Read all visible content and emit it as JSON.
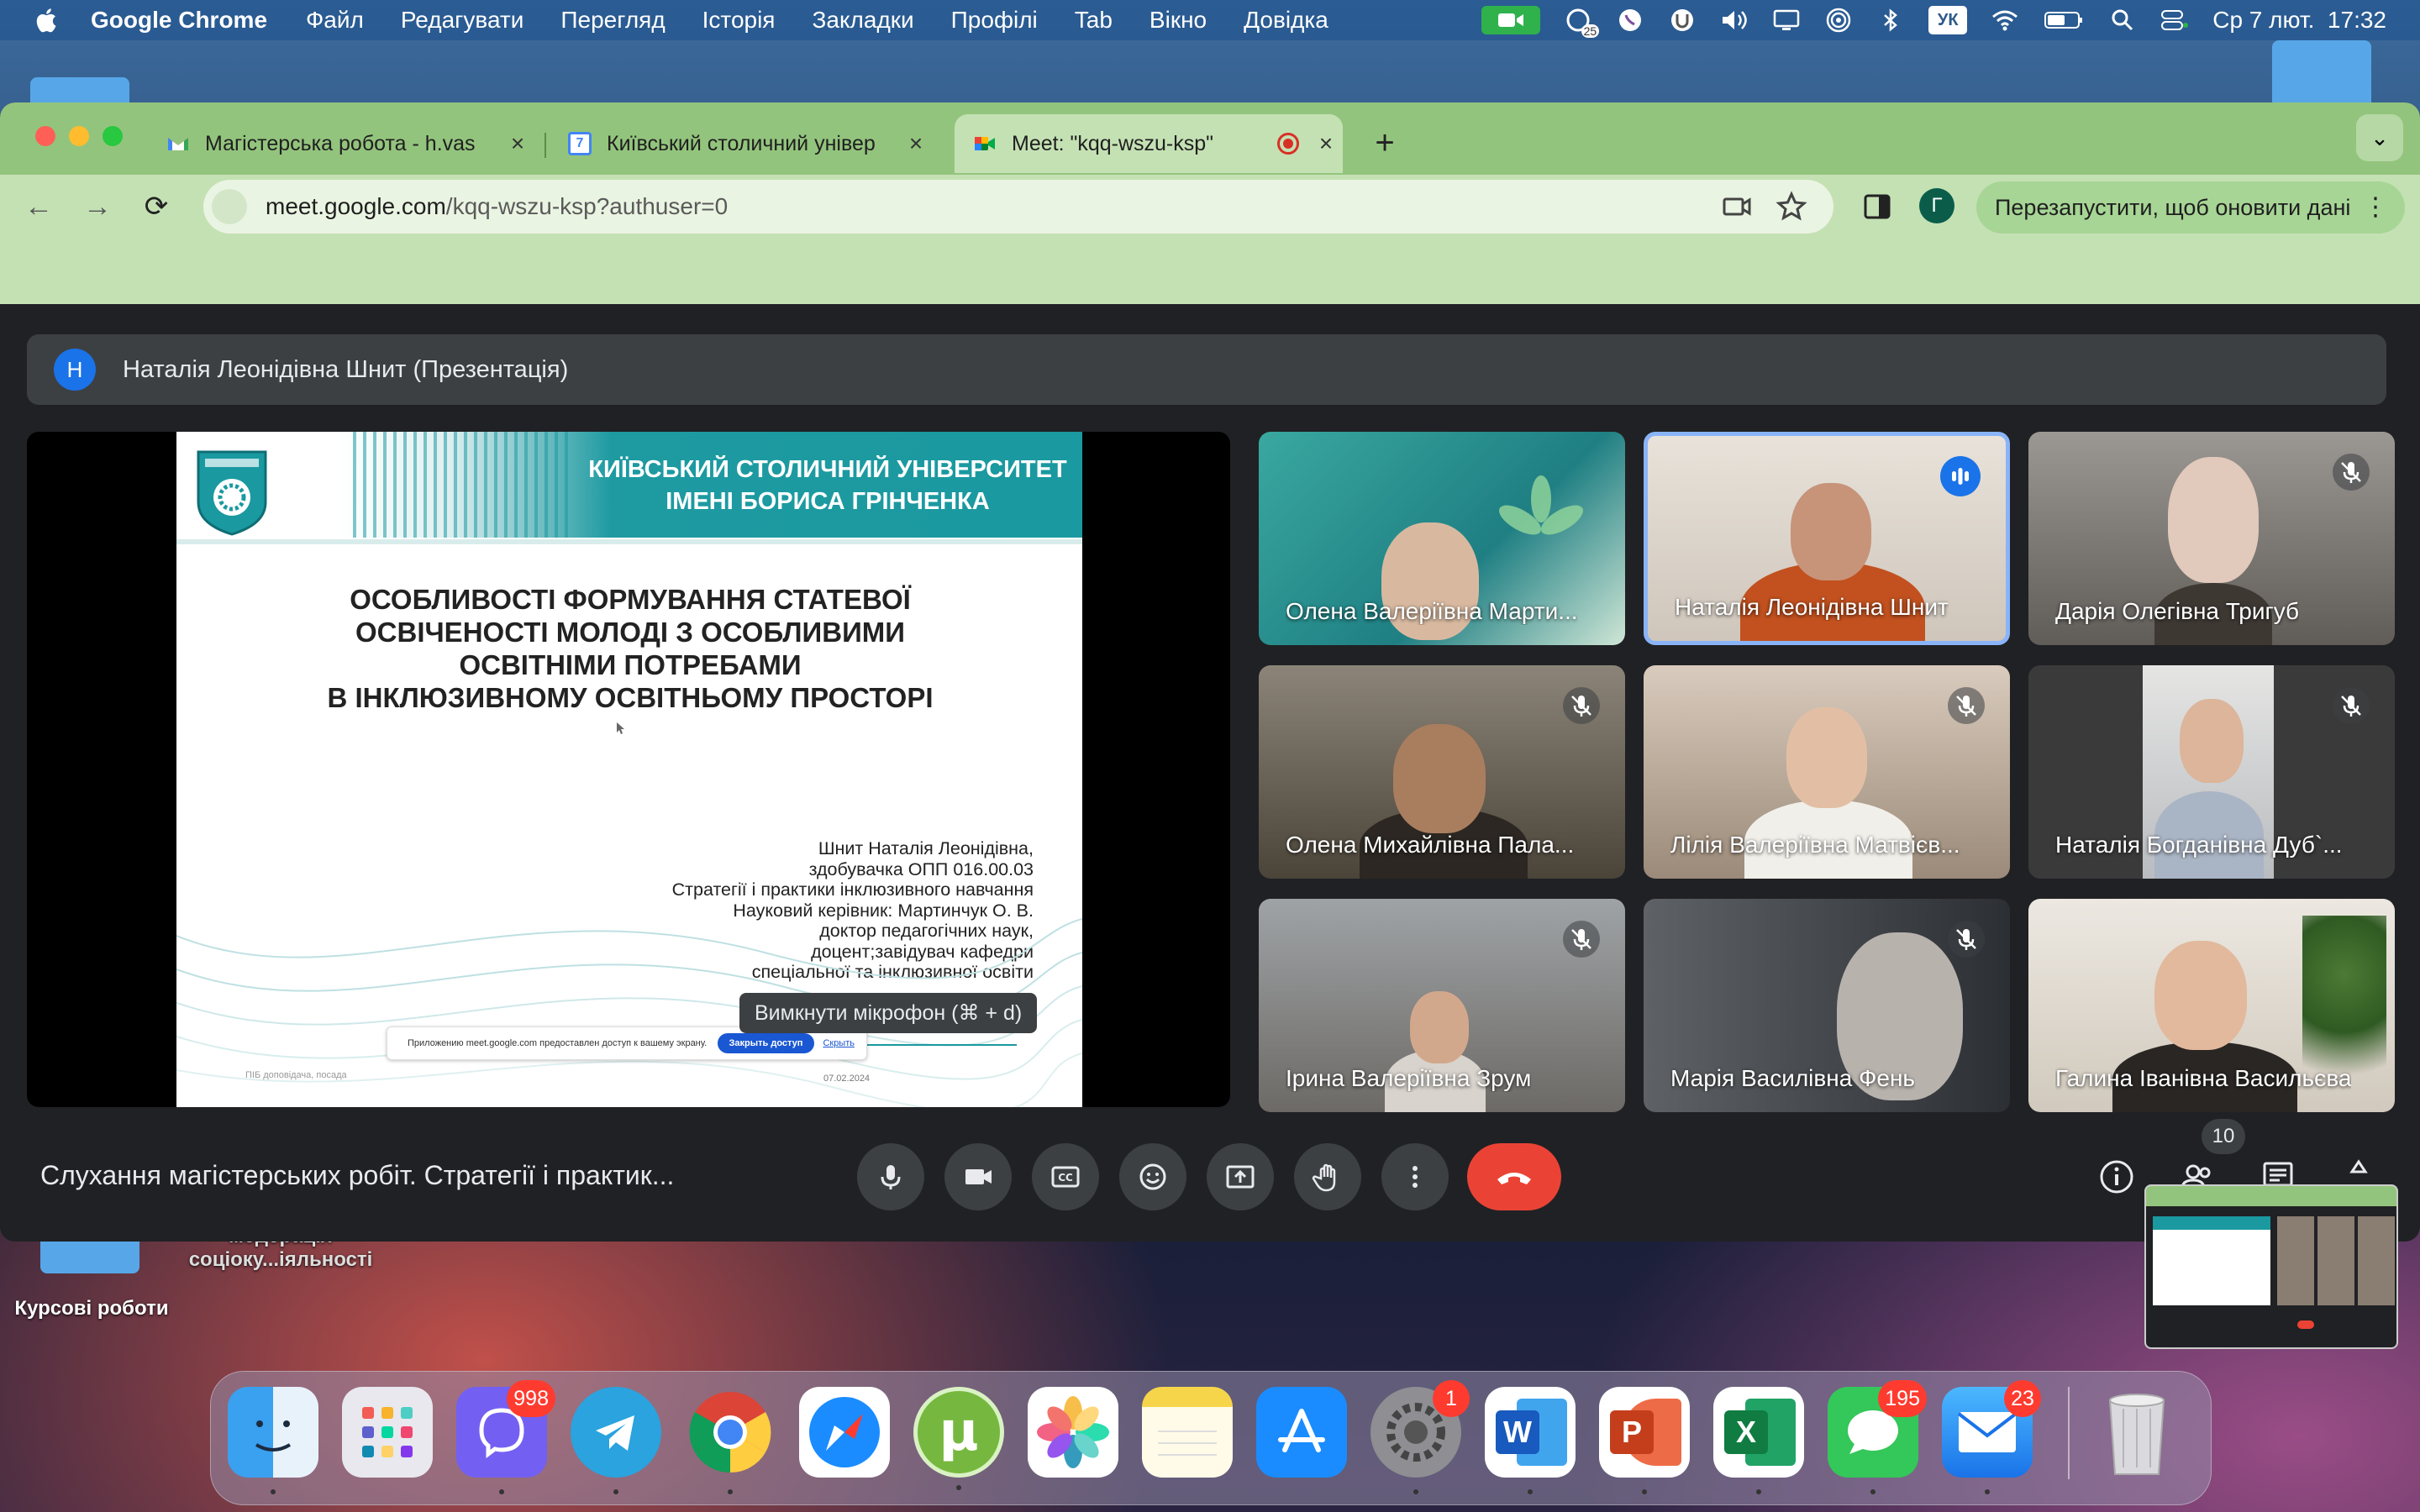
{
  "menubar": {
    "app_name": "Google Chrome",
    "menus": [
      "Файл",
      "Редагувати",
      "Перегляд",
      "Історія",
      "Закладки",
      "Профілі",
      "Tab",
      "Вікно",
      "Довідка"
    ],
    "keyboard_layout": "УК",
    "datetime": "Ср 7 лют.  17:32",
    "status_badge_count": "25"
  },
  "desktop": {
    "folder_labels": [
      "Курсові роботи",
      "модерація соціоку...іяльності"
    ]
  },
  "browser": {
    "tabs": [
      {
        "title": "Магістерська робота - h.vas",
        "icon": "gmail-icon"
      },
      {
        "title": "Київський столичний універ",
        "icon": "calendar-icon",
        "icon_text": "7"
      },
      {
        "title": "Meet: \"kqq-wszu-ksp\"",
        "icon": "meet-icon",
        "active": true
      }
    ],
    "url_domain": "meet.google.com",
    "url_path": "/kqq-wszu-ksp?authuser=0",
    "profile_initial": "Г",
    "relaunch_label": "Перезапустити, щоб оновити дані"
  },
  "meet": {
    "presenter_initial": "Н",
    "presenter_label": "Наталія Леонідівна Шнит (Презентація)",
    "slide": {
      "university": "КИЇВСЬКИЙ СТОЛИЧНИЙ УНІВЕРСИТЕТ\nІМЕНІ БОРИСА ГРІНЧЕНКА",
      "title": "ОСОБЛИВОСТІ ФОРМУВАННЯ СТАТЕВОЇ\nОСВІЧЕНОСТІ МОЛОДІ З ОСОБЛИВИМИ\nОСВІТНІМИ ПОТРЕБАМИ\nВ ІНКЛЮЗИВНОМУ ОСВІТНЬОМУ ПРОСТОРІ",
      "author_block": "Шнит Наталія Леонідівна,\nздобувачка ОПП 016.00.03\nСтратегії і практики інклюзивного навчання\nНауковий керівник: Мартинчук О. В.\nдоктор педагогічних наук,\nдоцент;завідувач кафедри\nспеціальної та інклюзивної освіти",
      "share_notice": "Приложению meet.google.com предоставлен доступ к вашему экрану.",
      "share_stop": "Закрыть доступ",
      "share_hide": "Скрыть",
      "footer_left": "ПІБ доповідача, посада",
      "date": "07.02.2024"
    },
    "participants": [
      {
        "name": "Олена Валеріївна Марти...",
        "muted": false
      },
      {
        "name": "Наталія Леонідівна Шнит",
        "speaking": true
      },
      {
        "name": "Дарія Олегівна Тригуб",
        "muted": true
      },
      {
        "name": "Олена Михайлівна Пала...",
        "muted": true
      },
      {
        "name": "Лілія Валеріївна Матвієв...",
        "muted": true
      },
      {
        "name": "Наталія Богданівна Дуб`...",
        "muted": true
      },
      {
        "name": "Ірина Валеріївна Зрум",
        "muted": true
      },
      {
        "name": "Марія Василівна Фень",
        "muted": true
      },
      {
        "name": "Галина Іванівна Васильєва",
        "muted": false
      }
    ],
    "tooltip": "Вимкнути мікрофон (⌘ + d)",
    "meeting_title": "Слухання магістерських робіт. Стратегії і практик...",
    "participant_count": "10"
  },
  "dock": {
    "apps": [
      {
        "name": "Finder"
      },
      {
        "name": "Launchpad"
      },
      {
        "name": "Viber",
        "badge": "998"
      },
      {
        "name": "Telegram"
      },
      {
        "name": "Chrome"
      },
      {
        "name": "Safari"
      },
      {
        "name": "uTorrent"
      },
      {
        "name": "Photos"
      },
      {
        "name": "Notes"
      },
      {
        "name": "App Store"
      },
      {
        "name": "System Settings",
        "badge": "1"
      },
      {
        "name": "Word"
      },
      {
        "name": "PowerPoint"
      },
      {
        "name": "Excel"
      },
      {
        "name": "Messages",
        "badge": "195"
      },
      {
        "name": "Mail",
        "badge": "23"
      },
      {
        "name": "Trash"
      }
    ]
  },
  "colors": {
    "chrome_frame": "#93c47d",
    "chrome_toolbar": "#c4e1b4",
    "meet_bg": "#202124",
    "end_call": "#ea4335",
    "speaking": "#1a73e8",
    "slide_teal": "#1a99a0"
  }
}
